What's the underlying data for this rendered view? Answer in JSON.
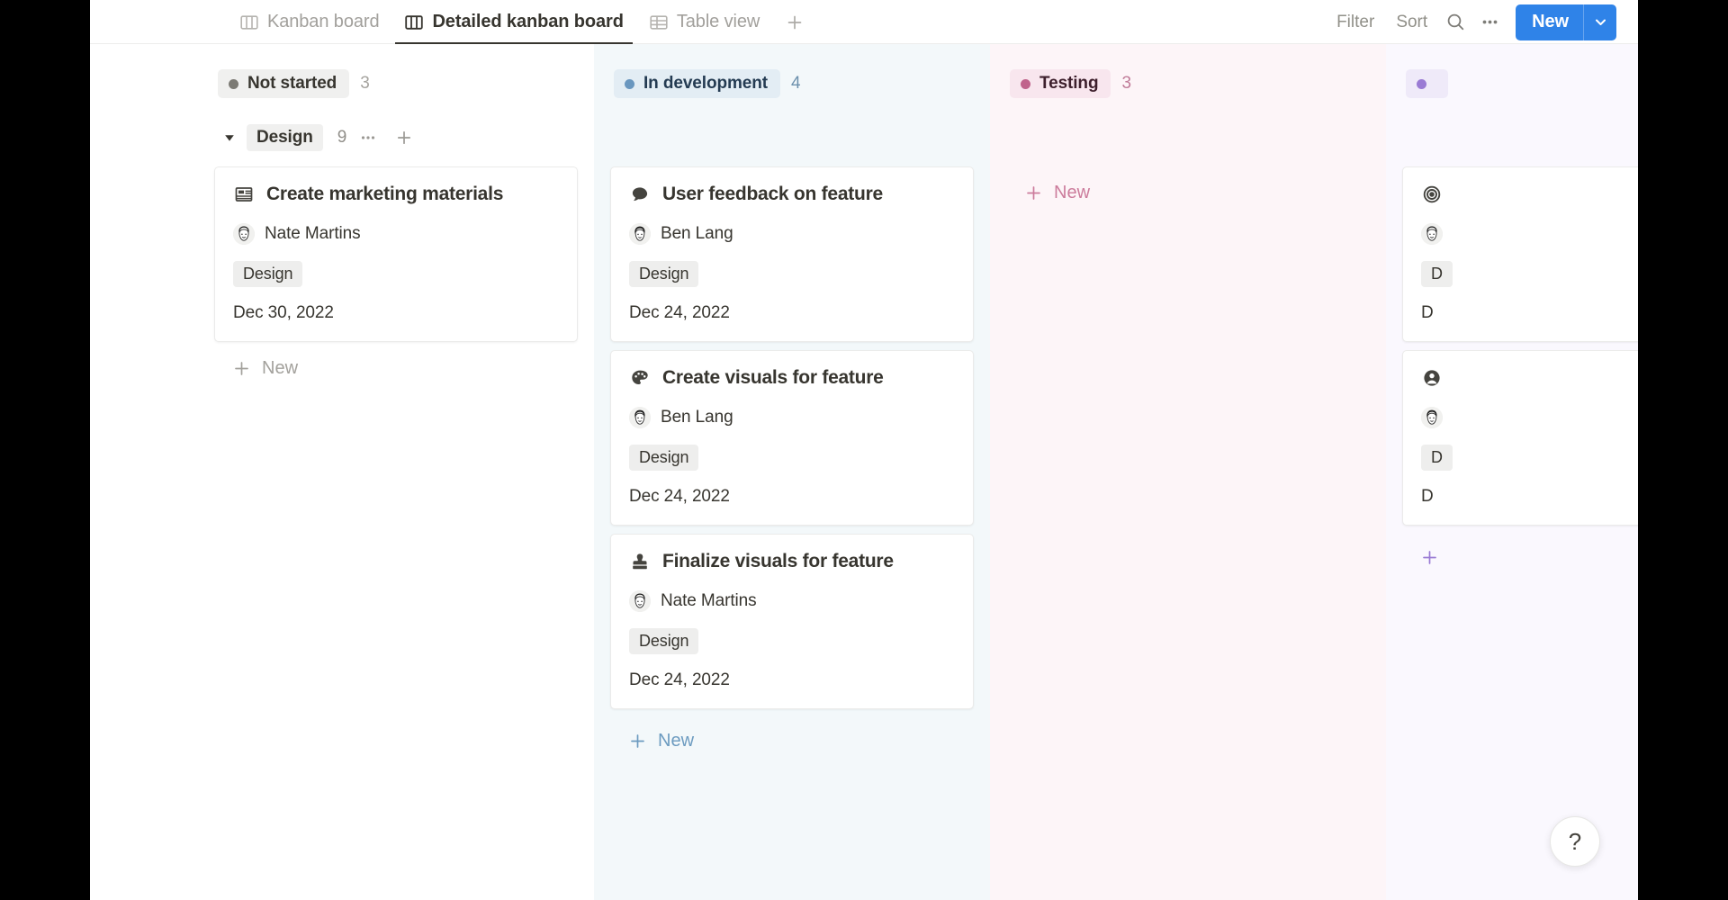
{
  "toolbar": {
    "tabs": [
      {
        "label": "Kanban board",
        "icon": "board-icon",
        "active": false
      },
      {
        "label": "Detailed kanban board",
        "icon": "board-icon",
        "active": true
      },
      {
        "label": "Table view",
        "icon": "table-icon",
        "active": false
      }
    ],
    "add_tab_label": "+",
    "filter_label": "Filter",
    "sort_label": "Sort",
    "search_icon": "search-icon",
    "more_icon": "more-horizontal-icon",
    "new_label": "New",
    "new_caret_icon": "chevron-down-icon",
    "new_button_color": "#2f83e8"
  },
  "board": {
    "columns": [
      {
        "status": "Not started",
        "count": "3",
        "dot_color": "#7c7a74",
        "pill_bg": "#f0f0ef",
        "pill_text": "#37352f",
        "count_color": "#a5a39e",
        "column_bg": "#ffffff",
        "new_label": "New",
        "new_color": "#a3a19c",
        "group": {
          "name": "Design",
          "count": "9",
          "caret_icon": "chevron-down-icon",
          "more_icon": "more-horizontal-icon",
          "plus_icon": "plus-icon"
        },
        "cards": [
          {
            "icon": "news-article-icon",
            "title": "Create marketing materials",
            "person": "Nate Martins",
            "avatar": "face-avatar-nate",
            "tag": "Design",
            "date": "Dec 30, 2022"
          }
        ]
      },
      {
        "status": "In development",
        "count": "4",
        "dot_color": "#6a97bf",
        "pill_bg": "#e3edf4",
        "pill_text": "#243b52",
        "count_color": "#6d91ad",
        "column_bg": "#f3f8fa",
        "new_label": "New",
        "new_color": "#6c9bc0",
        "cards": [
          {
            "icon": "speech-bubble-icon",
            "title": "User feedback on feature",
            "person": "Ben Lang",
            "avatar": "face-avatar-ben",
            "tag": "Design",
            "date": "Dec 24, 2022"
          },
          {
            "icon": "palette-icon",
            "title": "Create visuals for feature",
            "person": "Ben Lang",
            "avatar": "face-avatar-ben",
            "tag": "Design",
            "date": "Dec 24, 2022"
          },
          {
            "icon": "stamp-icon",
            "title": "Finalize visuals for feature",
            "person": "Nate Martins",
            "avatar": "face-avatar-nate",
            "tag": "Design",
            "date": "Dec 24, 2022"
          }
        ]
      },
      {
        "status": "Testing",
        "count": "3",
        "dot_color": "#c0648c",
        "pill_bg": "#f8e6ee",
        "pill_text": "#3d1f2c",
        "count_color": "#c07b98",
        "column_bg": "#fdf5f8",
        "new_label": "New",
        "new_color": "#cc7c9c",
        "cards": []
      },
      {
        "status": "",
        "count": "",
        "dot_color": "#9a7bd4",
        "pill_bg": "#efeaf9",
        "pill_text": "#2e2342",
        "count_color": "#9a7bd4",
        "column_bg": "#faf8fe",
        "new_label": "",
        "new_color": "#9a7bd4",
        "cards": [
          {
            "icon": "target-icon",
            "title": "",
            "person": "",
            "avatar": "face-avatar-nate",
            "tag": "D",
            "date": "D"
          },
          {
            "icon": "person-circle-icon",
            "title": "",
            "person": "",
            "avatar": "face-avatar-ben",
            "tag": "D",
            "date": "D"
          }
        ]
      }
    ]
  },
  "help": {
    "label": "?"
  }
}
